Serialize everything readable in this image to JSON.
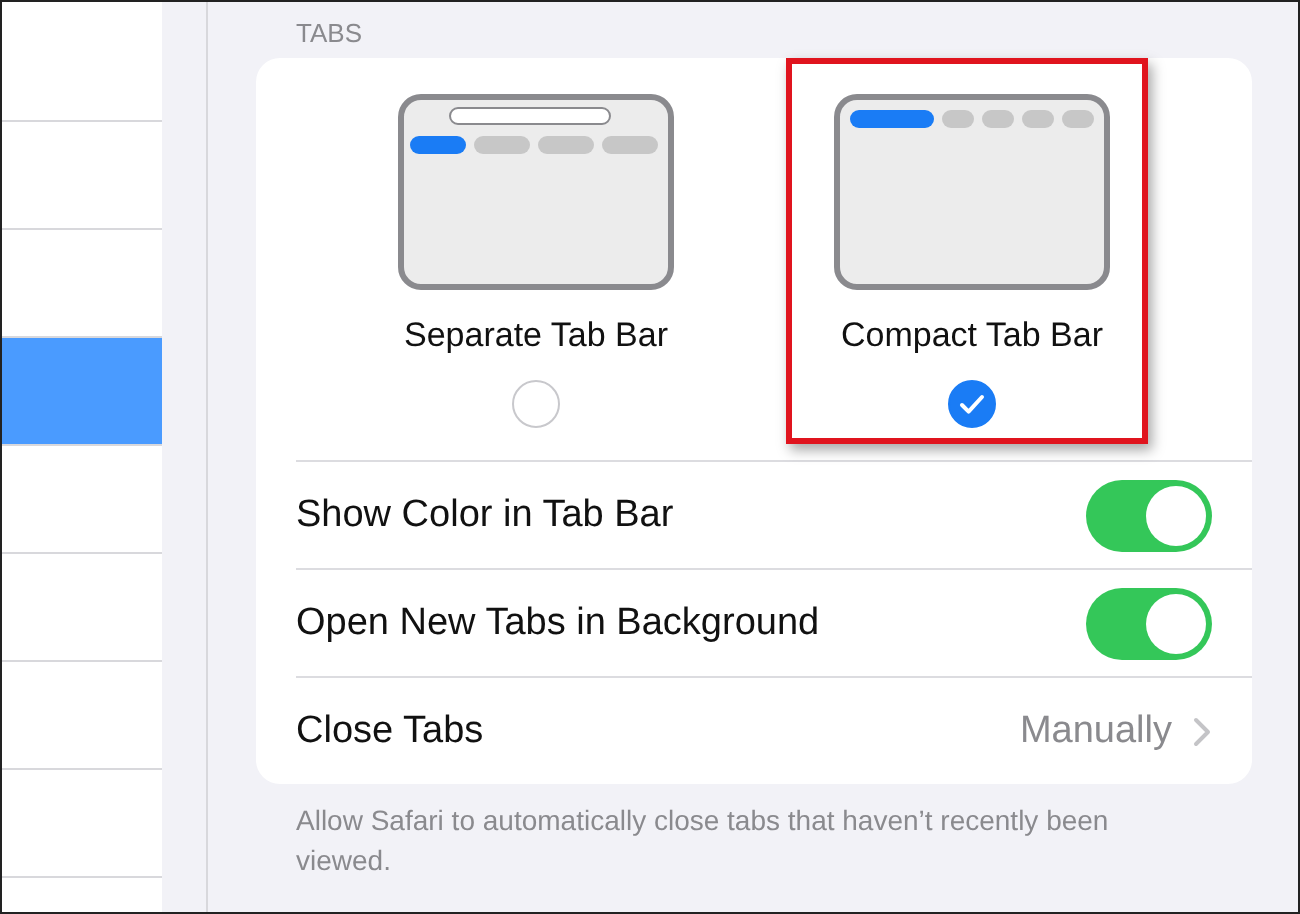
{
  "sidebar": {
    "items": [
      {
        "selected": false
      },
      {
        "selected": false
      },
      {
        "selected": false
      },
      {
        "selected": true
      },
      {
        "selected": false
      },
      {
        "selected": false
      },
      {
        "selected": false
      },
      {
        "selected": false
      }
    ]
  },
  "section": {
    "header": "TABS",
    "options": [
      {
        "kind": "separate",
        "label": "Separate Tab Bar",
        "selected": false,
        "highlighted": false
      },
      {
        "kind": "compact",
        "label": "Compact Tab Bar",
        "selected": true,
        "highlighted": true
      }
    ],
    "rows": [
      {
        "kind": "toggle",
        "label": "Show Color in Tab Bar",
        "on": true
      },
      {
        "kind": "toggle",
        "label": "Open New Tabs in Background",
        "on": true
      },
      {
        "kind": "link",
        "label": "Close Tabs",
        "value": "Manually"
      }
    ],
    "footer": "Allow Safari to automatically close tabs that haven’t recently been viewed."
  }
}
